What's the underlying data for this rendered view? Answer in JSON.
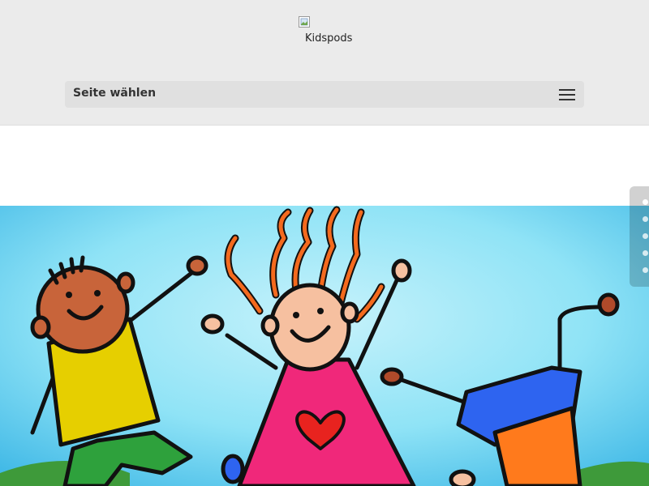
{
  "header": {
    "logo_alt": "Kidspods",
    "logo_icon": "broken-image-icon"
  },
  "nav": {
    "select_label": "Seite wählen",
    "menu_icon": "hamburger-menu-icon"
  },
  "hero": {
    "image_description_icon": "kids-illustration",
    "colors": {
      "sky": "#5fd0ee",
      "grass": "#3e9a3a",
      "shirt_yellow": "#e6cf00",
      "dress_pink": "#f0287a",
      "hair_orange": "#f46a1e",
      "pants_blue": "#2e64f0",
      "shorts_orange": "#ff7a1c"
    }
  },
  "dot_nav": {
    "count": 5,
    "active_index": 0
  }
}
